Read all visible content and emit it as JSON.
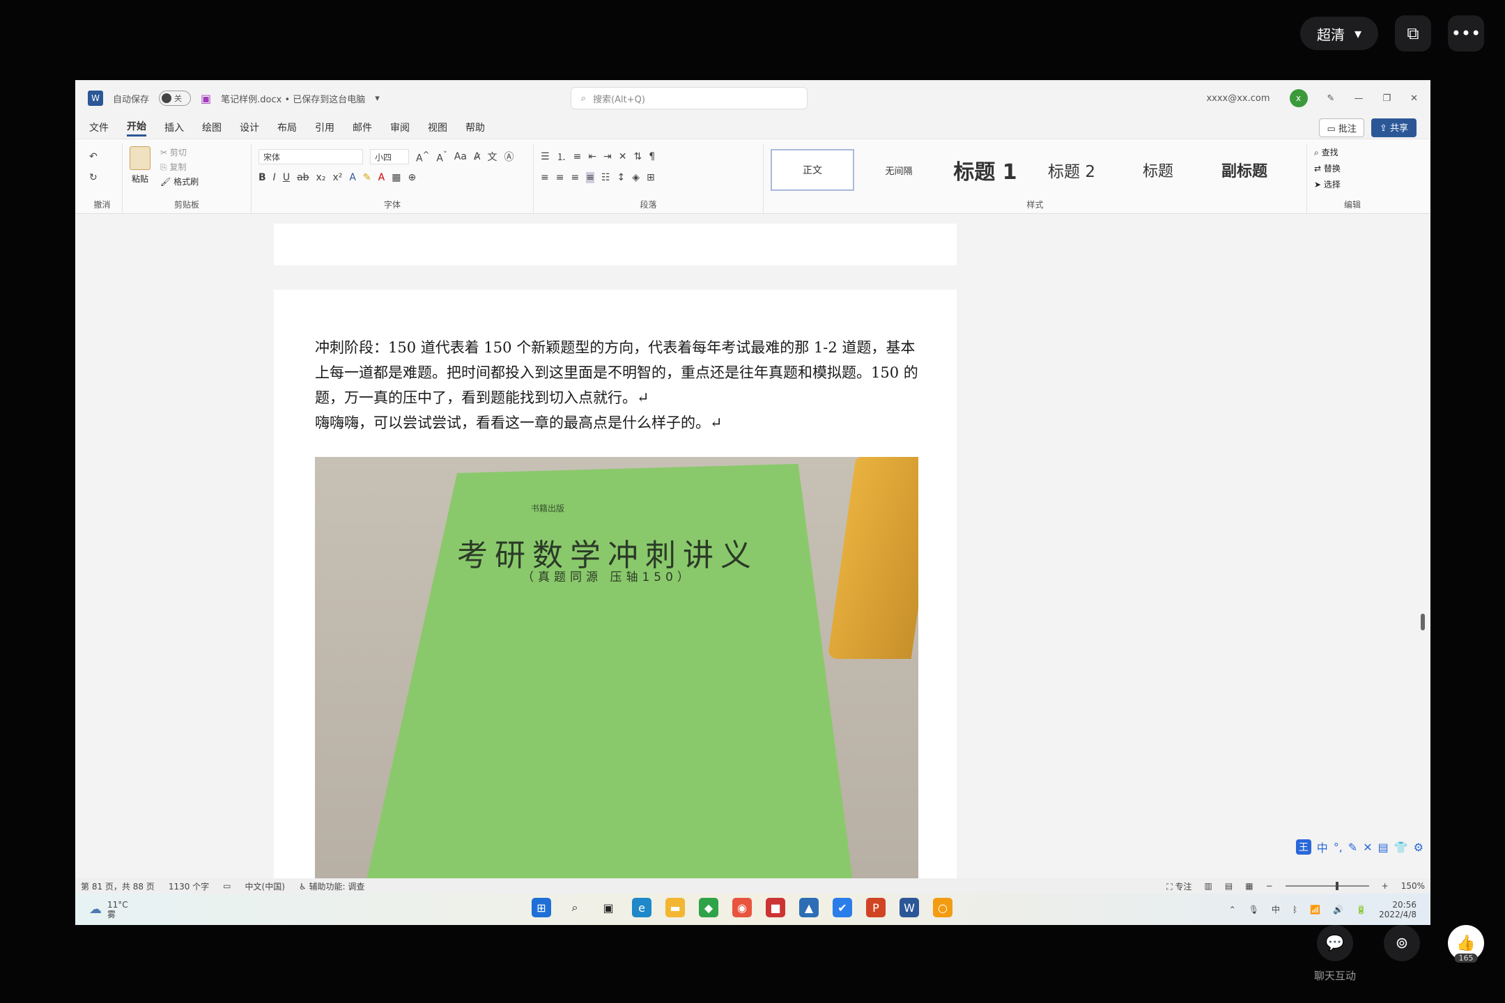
{
  "player": {
    "quality_label": "超清",
    "chat_label": "聊天互动",
    "like_count": "165"
  },
  "titlebar": {
    "autosave_label": "自动保存",
    "autosave_state": "关",
    "doc_title": "笔记样例.docx • 已保存到这台电脑",
    "search_placeholder": "搜索(Alt+Q)",
    "user_email": "xxxx@xx.com",
    "user_initial": "x"
  },
  "menu": {
    "items": [
      "文件",
      "开始",
      "插入",
      "绘图",
      "设计",
      "布局",
      "引用",
      "邮件",
      "审阅",
      "视图",
      "帮助"
    ],
    "active_index": 1,
    "comment_label": "批注",
    "share_label": "共享"
  },
  "ribbon": {
    "undo_group": "撤消",
    "clipboard_group": "剪贴板",
    "paste_label": "粘贴",
    "cut_label": "剪切",
    "copy_label": "复制",
    "format_painter_label": "格式刷",
    "font_name": "宋体",
    "font_size": "小四",
    "font_group": "字体",
    "paragraph_group": "段落",
    "styles_group": "样式",
    "styles": [
      "正文",
      "无间隔",
      "标题 1",
      "标题 2",
      "标题",
      "副标题"
    ],
    "find_label": "查找",
    "replace_label": "替换",
    "select_label": "选择",
    "edit_group": "编辑"
  },
  "document": {
    "paragraph1": "冲刺阶段：150 道代表着 150 个新颖题型的方向，代表着每年考试最难的那 1-2 道题，基本上每一道都是难题。把时间都投入到这里面是不明智的，重点还是往年真题和模拟题。150 的题，万一真的压中了，看到题能找到切入点就行。↵",
    "paragraph2": "嗨嗨嗨，可以尝试尝试，看看这一章的最高点是什么样子的。↵",
    "image": {
      "book_title": "考研数学冲刺讲义",
      "book_subtitle": "（真题同源  压轴150）",
      "publisher": "书籍出版"
    }
  },
  "ime_label": "中",
  "statusbar": {
    "page_info": "第 81 页，共 88 页",
    "word_count": "1130 个字",
    "language": "中文(中国)",
    "accessibility": "辅助功能: 调查",
    "focus_label": "专注",
    "zoom": "150%"
  },
  "taskbar": {
    "temperature": "11°C",
    "weather": "雾",
    "time": "20:56",
    "date": "2022/4/8"
  }
}
